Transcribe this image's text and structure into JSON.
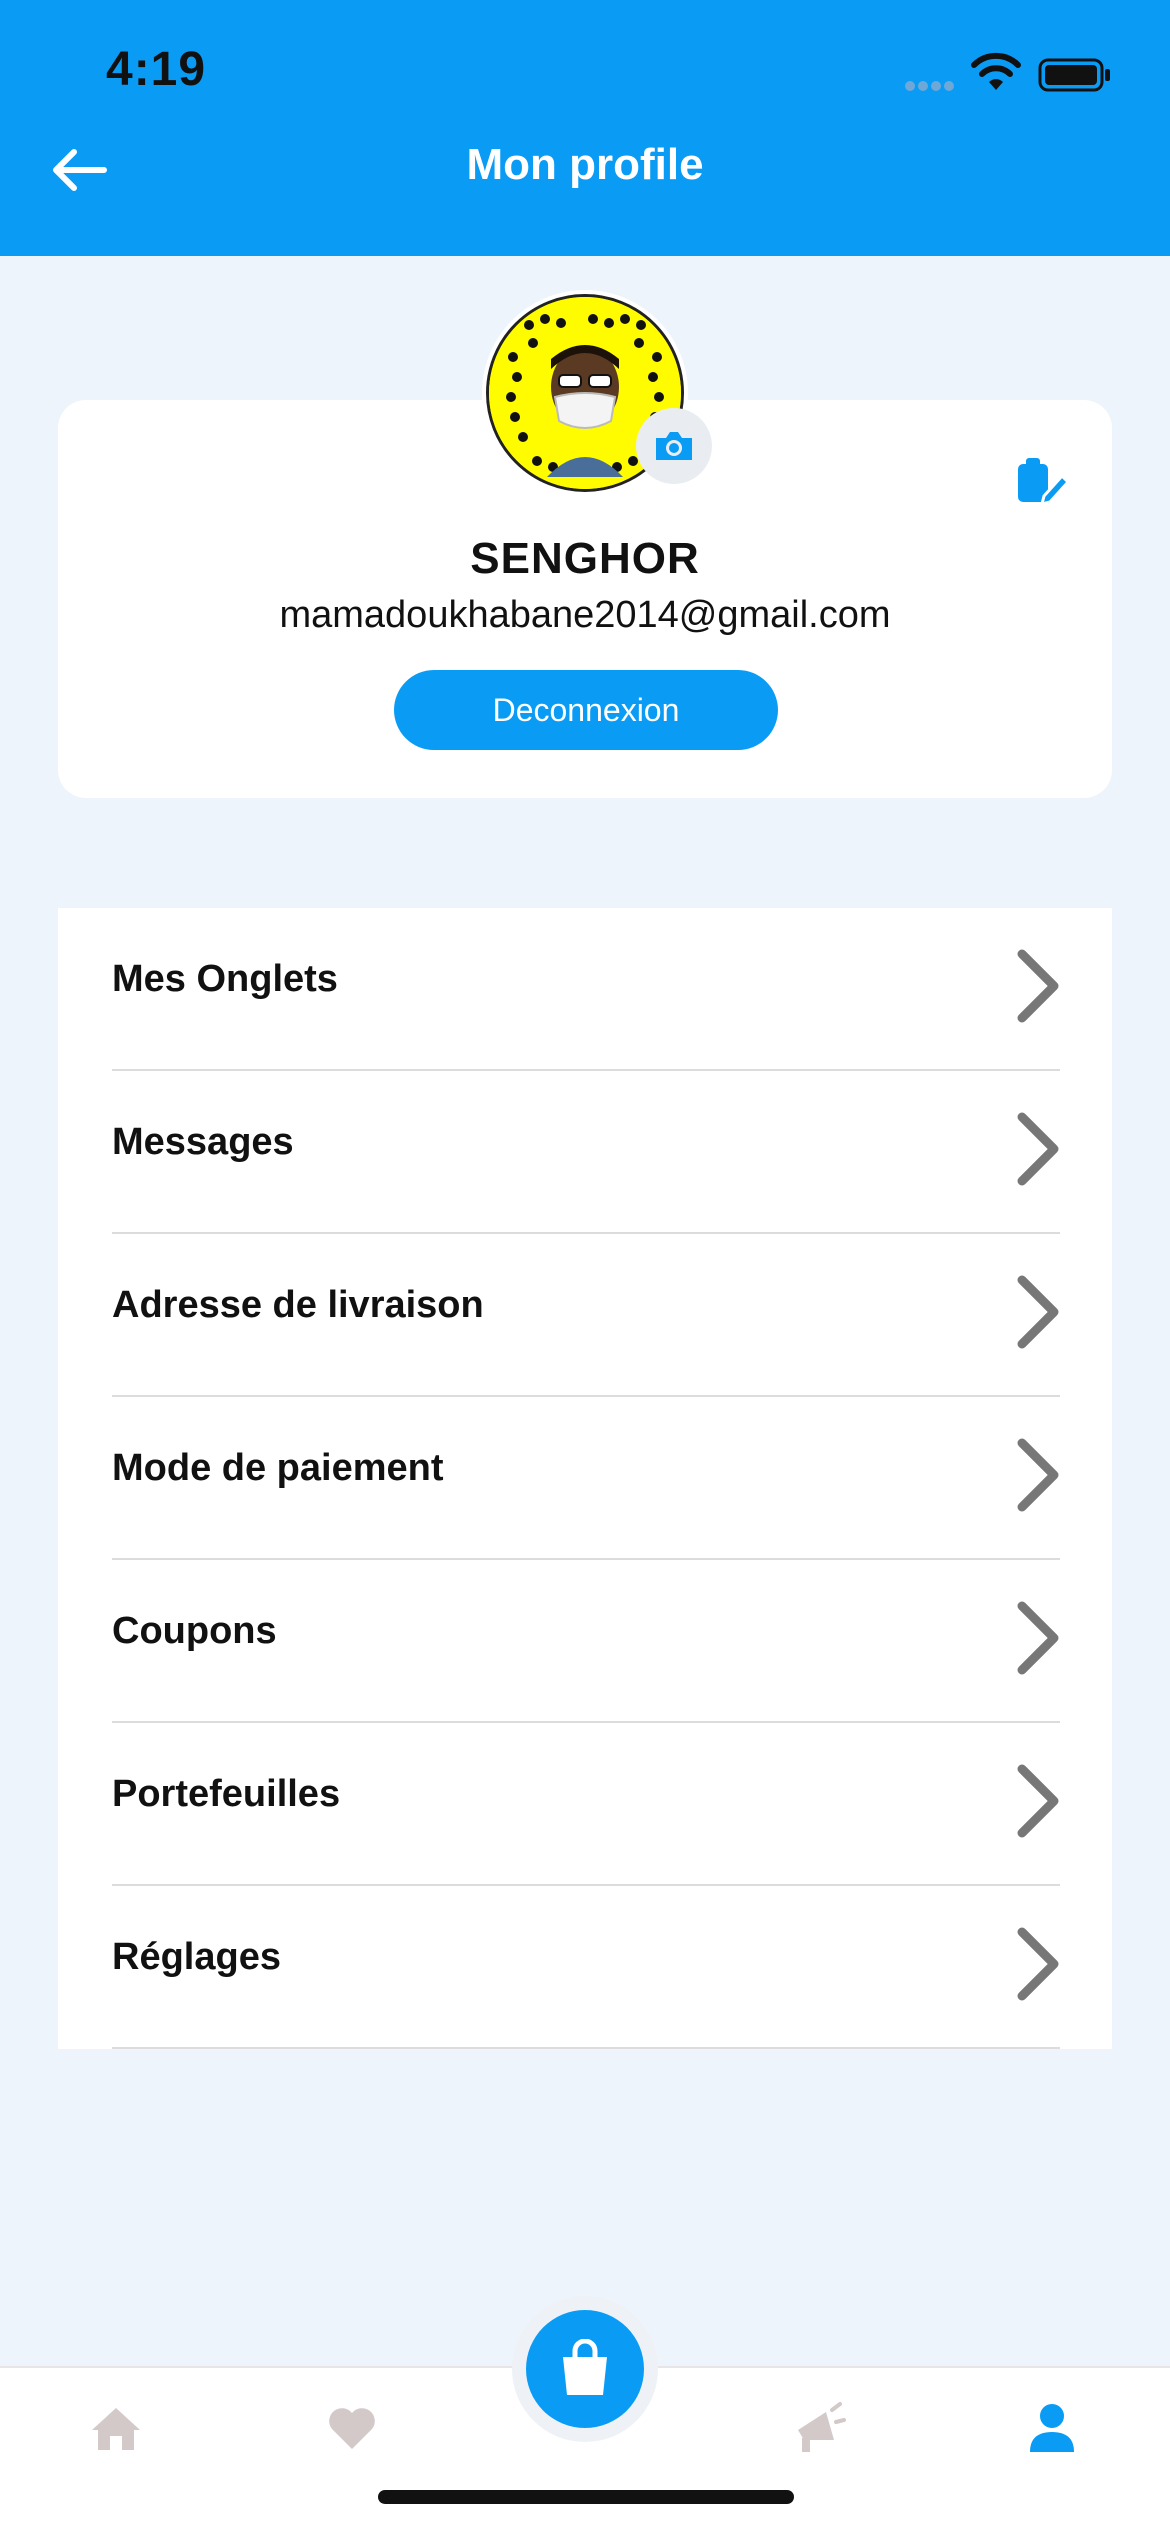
{
  "status_bar": {
    "time": "4:19"
  },
  "header": {
    "title": "Mon profile"
  },
  "profile": {
    "name": "SENGHOR",
    "email": "mamadoukhabane2014@gmail.com",
    "logout_label": "Deconnexion"
  },
  "menu": {
    "items": [
      {
        "label": "Mes Onglets"
      },
      {
        "label": "Messages"
      },
      {
        "label": "Adresse de livraison"
      },
      {
        "label": "Mode de paiement"
      },
      {
        "label": "Coupons"
      },
      {
        "label": "Portefeuilles"
      },
      {
        "label": "Réglages"
      }
    ]
  },
  "tabbar": {
    "tabs": [
      "home-icon",
      "heart-icon",
      "cart-icon",
      "megaphone-icon",
      "user-icon"
    ],
    "active": "user-icon"
  },
  "colors": {
    "accent": "#0a9cf5",
    "background": "#eef4fb",
    "inactive_tab": "#d3c9c9"
  }
}
